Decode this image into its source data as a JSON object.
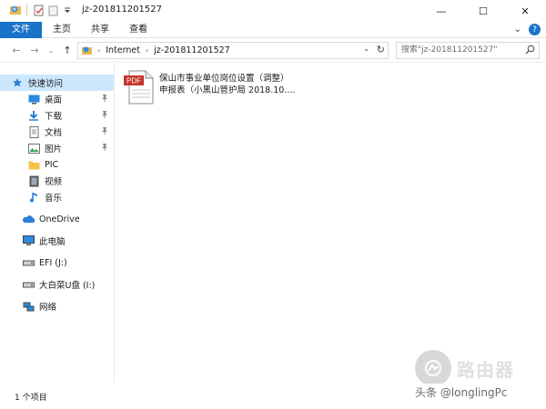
{
  "window": {
    "title": "jz-201811201527",
    "minimize_glyph": "—",
    "maximize_glyph": "☐",
    "close_glyph": "✕"
  },
  "ribbon": {
    "tabs": [
      {
        "label": "文件",
        "active": true
      },
      {
        "label": "主页",
        "active": false
      },
      {
        "label": "共享",
        "active": false
      },
      {
        "label": "查看",
        "active": false
      }
    ],
    "collapse_glyph": "⌄",
    "help_glyph": "?",
    "accent_color": "#1a73c9"
  },
  "navigation": {
    "back_glyph": "←",
    "forward_glyph": "→",
    "recent_glyph": "⌄",
    "up_glyph": "↑",
    "breadcrumbs": [
      "Internet",
      "jz-201811201527"
    ],
    "breadcrumb_sep": "›",
    "search_placeholder": "搜索\"jz-201811201527\""
  },
  "sidebar": {
    "items": [
      {
        "label": "快速访问",
        "icon": "star-icon",
        "pinned": false,
        "selected": true
      },
      {
        "label": "桌面",
        "icon": "desktop-icon",
        "pinned": true
      },
      {
        "label": "下载",
        "icon": "download-icon",
        "pinned": true
      },
      {
        "label": "文档",
        "icon": "document-icon",
        "pinned": true
      },
      {
        "label": "图片",
        "icon": "pictures-icon",
        "pinned": true
      },
      {
        "label": "PIC",
        "icon": "folder-icon",
        "pinned": false
      },
      {
        "label": "视频",
        "icon": "video-icon",
        "pinned": false
      },
      {
        "label": "音乐",
        "icon": "music-icon",
        "pinned": false
      },
      {
        "label": "OneDrive",
        "icon": "cloud-icon"
      },
      {
        "label": "此电脑",
        "icon": "computer-icon"
      },
      {
        "label": "EFI (J:)",
        "icon": "drive-icon"
      },
      {
        "label": "大白菜U盘 (I:)",
        "icon": "drive-icon"
      },
      {
        "label": "网络",
        "icon": "network-icon"
      }
    ]
  },
  "content": {
    "files": [
      {
        "line1": "保山市事业单位岗位设置（调整）",
        "line2": "申报表（小黑山管护局  2018.10....",
        "icon": "pdf-file-icon",
        "badge": "PDF"
      }
    ]
  },
  "status": {
    "item_count": "1 个项目"
  },
  "watermark": {
    "brand": "路由器",
    "caption": "头条 @longlingPc"
  }
}
